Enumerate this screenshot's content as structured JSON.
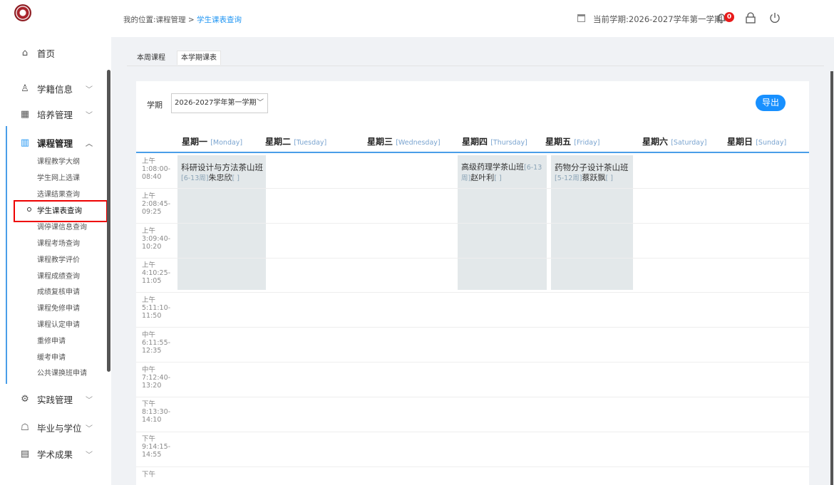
{
  "sidebar": {
    "top_items": [
      {
        "label": "首页",
        "icon": "home-icon"
      },
      {
        "label": "学籍信息",
        "icon": "user-icon"
      },
      {
        "label": "培养管理",
        "icon": "training-icon"
      },
      {
        "label": "课程管理",
        "icon": "course-icon"
      }
    ],
    "sub_items": [
      "课程教学大纲",
      "学生网上选课",
      "选课结果查询",
      "学生课表查询",
      "调停课信息查询",
      "课程考场查询",
      "课程教学评价",
      "课程成绩查询",
      "成绩复核申请",
      "课程免修申请",
      "课程认定申请",
      "重修申请",
      "缓考申请",
      "公共课换班申请"
    ],
    "bottom_items": [
      {
        "label": "实践管理",
        "icon": "practice-icon"
      },
      {
        "label": "毕业与学位",
        "icon": "graduation-icon"
      },
      {
        "label": "学术成果",
        "icon": "achievement-icon"
      }
    ]
  },
  "header": {
    "breadcrumb_prefix": "我的位置:课程管理 > ",
    "breadcrumb_current": "学生课表查询",
    "term_text": "当前学期:2026-2027学年第一学期",
    "notif_count": "0"
  },
  "tabs": [
    "本周课程",
    "本学期课表"
  ],
  "filter": {
    "label": "学期",
    "selected": "2026-2027学年第一学期",
    "export_label": "导出"
  },
  "days": [
    {
      "cn": "星期一",
      "en": "[Monday]"
    },
    {
      "cn": "星期二",
      "en": "[Tuesday]"
    },
    {
      "cn": "星期三",
      "en": "[Wednesday]"
    },
    {
      "cn": "星期四",
      "en": "[Thursday]"
    },
    {
      "cn": "星期五",
      "en": "[Friday]"
    },
    {
      "cn": "星期六",
      "en": "[Saturday]"
    },
    {
      "cn": "星期日",
      "en": "[Sunday]"
    }
  ],
  "periods": [
    [
      "上午",
      "1:08:00-",
      "08:40"
    ],
    [
      "上午",
      "2:08:45-",
      "09:25"
    ],
    [
      "上午",
      "3:09:40-",
      "10:20"
    ],
    [
      "上午",
      "4:10:25-",
      "11:05"
    ],
    [
      "上午",
      "5:11:10-",
      "11:50"
    ],
    [
      "中午",
      "6:11:55-",
      "12:35"
    ],
    [
      "中午",
      "7:12:40-",
      "13:20"
    ],
    [
      "下午",
      "8:13:30-",
      "14:10"
    ],
    [
      "下午",
      "9:14:15-",
      "14:55"
    ],
    [
      "下午",
      "",
      ""
    ]
  ],
  "courses": [
    {
      "name": "科研设计与方法茶山班",
      "weeks": "[6-13周]",
      "teacher": "朱忠欣",
      "room": "[ ]"
    },
    {
      "name": "高级药理学茶山班",
      "weeks": "[6-13周]",
      "teacher": "赵叶利",
      "room": "[ ]"
    },
    {
      "name": "药物分子设计茶山班",
      "weeks": "[5-12周]",
      "teacher": "蔡跃飘",
      "room": "[ ]"
    }
  ],
  "colors": {
    "accent": "#1890ff",
    "active_bar": "#4a9ee8",
    "badge": "#e81a1a",
    "highlight": "#ee0000",
    "course_bg": "#e3e8ea"
  }
}
